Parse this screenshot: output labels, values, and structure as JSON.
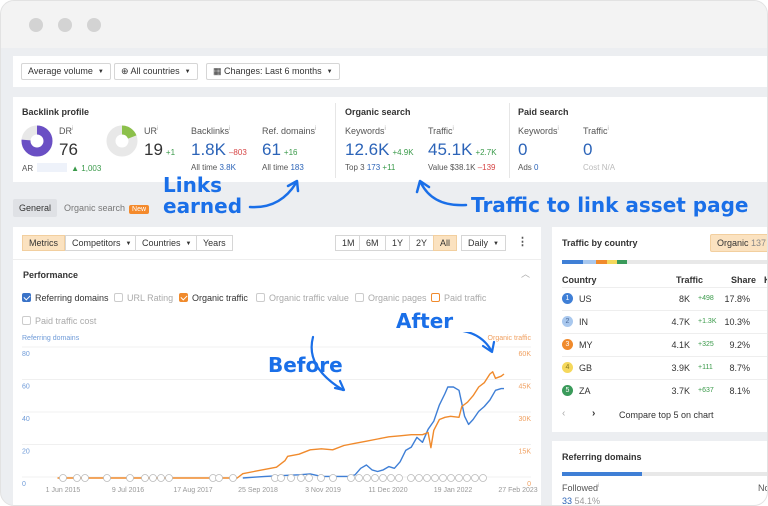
{
  "filters": {
    "volume": "Average volume",
    "countries": "All countries",
    "changes": "Changes: Last 6 months"
  },
  "backlink_profile": {
    "title": "Backlink profile",
    "dr": {
      "label": "DR",
      "value": "76",
      "percent": 76
    },
    "ur": {
      "label": "UR",
      "value": "19",
      "delta": "+1",
      "percent": 19
    },
    "ar": {
      "label": "AR",
      "delta": "1,003"
    },
    "backlinks": {
      "label": "Backlinks",
      "value": "1.8K",
      "delta": "–803",
      "sub_label": "All time",
      "sub_value": "3.8K"
    },
    "ref_domains": {
      "label": "Ref. domains",
      "value": "61",
      "delta": "+16",
      "sub_label": "All time",
      "sub_value": "183"
    }
  },
  "organic_search": {
    "title": "Organic search",
    "keywords": {
      "label": "Keywords",
      "value": "12.6K",
      "delta": "+4.9K",
      "sub_label": "Top 3",
      "sub_value": "173",
      "sub_delta": "+11"
    },
    "traffic": {
      "label": "Traffic",
      "value": "45.1K",
      "delta": "+2.7K",
      "sub_label": "Value",
      "sub_value": "$38.1K",
      "sub_delta": "–139"
    }
  },
  "paid_search": {
    "title": "Paid search",
    "keywords": {
      "label": "Keywords",
      "value": "0",
      "sub_label": "Ads",
      "sub_value": "0"
    },
    "traffic": {
      "label": "Traffic",
      "value": "0",
      "sub_label": "Cost",
      "sub_value": "N/A"
    }
  },
  "annotations": {
    "links_earned_1": "Links",
    "links_earned_2": "earned",
    "traffic_asset": "Traffic to link asset page",
    "before": "Before",
    "after": "After"
  },
  "tabs": [
    {
      "label": "General",
      "active": true
    },
    {
      "label": "Organic search",
      "badge": "New"
    }
  ],
  "chart_toolbar": {
    "left": [
      "Metrics",
      "Competitors",
      "Countries",
      "Years"
    ],
    "ranges": [
      "1M",
      "6M",
      "1Y",
      "2Y",
      "All"
    ],
    "active_range": "All",
    "interval": "Daily"
  },
  "performance": {
    "title": "Performance",
    "checkboxes": [
      {
        "label": "Referring domains",
        "checked": true,
        "color": "#3a73c8"
      },
      {
        "label": "URL Rating",
        "checked": false
      },
      {
        "label": "Organic traffic",
        "checked": true,
        "color": "#f08a2c"
      },
      {
        "label": "Organic traffic value",
        "checked": false
      },
      {
        "label": "Organic pages",
        "checked": false
      },
      {
        "label": "Paid traffic",
        "checked": false,
        "color": "#f08a2c"
      },
      {
        "label": "Paid traffic cost",
        "checked": false
      }
    ]
  },
  "chart_data": {
    "type": "line",
    "left_axis_label": "Referring domains",
    "right_axis_label": "Organic traffic",
    "left_ticks": [
      "0",
      "20",
      "40",
      "60",
      "80"
    ],
    "right_ticks": [
      "0",
      "15K",
      "30K",
      "45K",
      "60K"
    ],
    "left_range": [
      0,
      80
    ],
    "right_range": [
      0,
      60000
    ],
    "x_ticks": [
      "1 Jun 2015",
      "9 Jul 2016",
      "17 Aug 2017",
      "25 Sep 2018",
      "3 Nov 2019",
      "11 Dec 2020",
      "19 Jan 2022",
      "27 Feb 2023"
    ],
    "x_range": [
      2015.0,
      2023.6
    ],
    "series": [
      {
        "name": "Referring domains",
        "axis": "left",
        "color": "#3f7fd6",
        "points": [
          [
            2018.7,
            0
          ],
          [
            2018.9,
            0.5
          ],
          [
            2019.1,
            1
          ],
          [
            2019.4,
            1.5
          ],
          [
            2019.7,
            2
          ],
          [
            2019.9,
            2.5
          ],
          [
            2020.1,
            1
          ],
          [
            2020.4,
            1
          ],
          [
            2020.6,
            1
          ],
          [
            2020.7,
            2
          ],
          [
            2020.8,
            6
          ],
          [
            2020.9,
            8
          ],
          [
            2021.0,
            5
          ],
          [
            2021.1,
            4
          ],
          [
            2021.2,
            5
          ],
          [
            2021.3,
            7
          ],
          [
            2021.4,
            6
          ],
          [
            2021.5,
            10
          ],
          [
            2021.6,
            17
          ],
          [
            2021.7,
            19
          ],
          [
            2021.8,
            25
          ],
          [
            2021.9,
            22
          ],
          [
            2022.0,
            30
          ],
          [
            2022.1,
            35
          ],
          [
            2022.2,
            45
          ],
          [
            2022.3,
            52
          ],
          [
            2022.35,
            56
          ],
          [
            2022.45,
            56
          ],
          [
            2022.55,
            54
          ],
          [
            2022.65,
            38
          ],
          [
            2022.72,
            33
          ],
          [
            2022.8,
            36
          ],
          [
            2022.9,
            41
          ],
          [
            2023.0,
            44
          ],
          [
            2023.1,
            48
          ],
          [
            2023.2,
            54
          ],
          [
            2023.3,
            55
          ],
          [
            2023.35,
            55
          ]
        ]
      },
      {
        "name": "Organic traffic",
        "axis": "right",
        "color": "#f08a2c",
        "points": [
          [
            2015.4,
            0
          ],
          [
            2018.6,
            0
          ],
          [
            2018.7,
            2000
          ],
          [
            2018.9,
            3000
          ],
          [
            2019.1,
            4000
          ],
          [
            2019.3,
            5000
          ],
          [
            2019.45,
            8000
          ],
          [
            2019.5,
            10000
          ],
          [
            2019.7,
            11000
          ],
          [
            2019.9,
            13000
          ],
          [
            2020.1,
            13500
          ],
          [
            2020.3,
            13000
          ],
          [
            2020.5,
            15000
          ],
          [
            2020.7,
            16000
          ],
          [
            2020.9,
            17000
          ],
          [
            2021.1,
            18000
          ],
          [
            2021.3,
            19000
          ],
          [
            2021.5,
            19500
          ],
          [
            2021.7,
            20000
          ],
          [
            2021.9,
            20000
          ],
          [
            2022.0,
            21000
          ],
          [
            2022.05,
            14000
          ],
          [
            2022.1,
            22000
          ],
          [
            2022.2,
            27000
          ],
          [
            2022.3,
            28000
          ],
          [
            2022.4,
            28500
          ],
          [
            2022.55,
            28000
          ],
          [
            2022.6,
            33000
          ],
          [
            2022.7,
            35000
          ],
          [
            2022.8,
            38000
          ],
          [
            2022.9,
            42000
          ],
          [
            2023.0,
            44000
          ],
          [
            2023.1,
            48000
          ],
          [
            2023.15,
            49000
          ],
          [
            2023.2,
            46000
          ],
          [
            2023.3,
            47000
          ],
          [
            2023.35,
            48000
          ]
        ]
      }
    ]
  },
  "traffic_by_country": {
    "title": "Traffic by country",
    "badge_label": "Organic",
    "badge_value": "137",
    "bar_segments": [
      {
        "color": "#3f7fd6",
        "share": 17.8
      },
      {
        "color": "#a9c8ee",
        "share": 10.3
      },
      {
        "color": "#f08a2c",
        "share": 9.2
      },
      {
        "color": "#f5d85c",
        "share": 8.7
      },
      {
        "color": "#3a9a5a",
        "share": 8.1
      }
    ],
    "columns": [
      "Country",
      "Traffic",
      "Share",
      "K"
    ],
    "rows": [
      {
        "rank": "1",
        "country": "US",
        "traffic": "8K",
        "delta": "+498",
        "share": "17.8%",
        "color": "#3f7fd6"
      },
      {
        "rank": "2",
        "country": "IN",
        "traffic": "4.7K",
        "delta": "+1.3K",
        "share": "10.3%",
        "color": "#a9c8ee"
      },
      {
        "rank": "3",
        "country": "MY",
        "traffic": "4.1K",
        "delta": "+325",
        "share": "9.2%",
        "color": "#f08a2c"
      },
      {
        "rank": "4",
        "country": "GB",
        "traffic": "3.9K",
        "delta": "+111",
        "share": "8.7%",
        "color": "#f5d85c"
      },
      {
        "rank": "5",
        "country": "ZA",
        "traffic": "3.7K",
        "delta": "+637",
        "share": "8.1%",
        "color": "#3a9a5a"
      }
    ],
    "compare_label": "Compare top 5 on chart"
  },
  "referring_domains_panel": {
    "title": "Referring domains",
    "followed_label": "Followed",
    "followed_value": "33",
    "followed_share": "54.1%",
    "followed_fraction": 0.541,
    "nofollow_label": "Nc"
  }
}
